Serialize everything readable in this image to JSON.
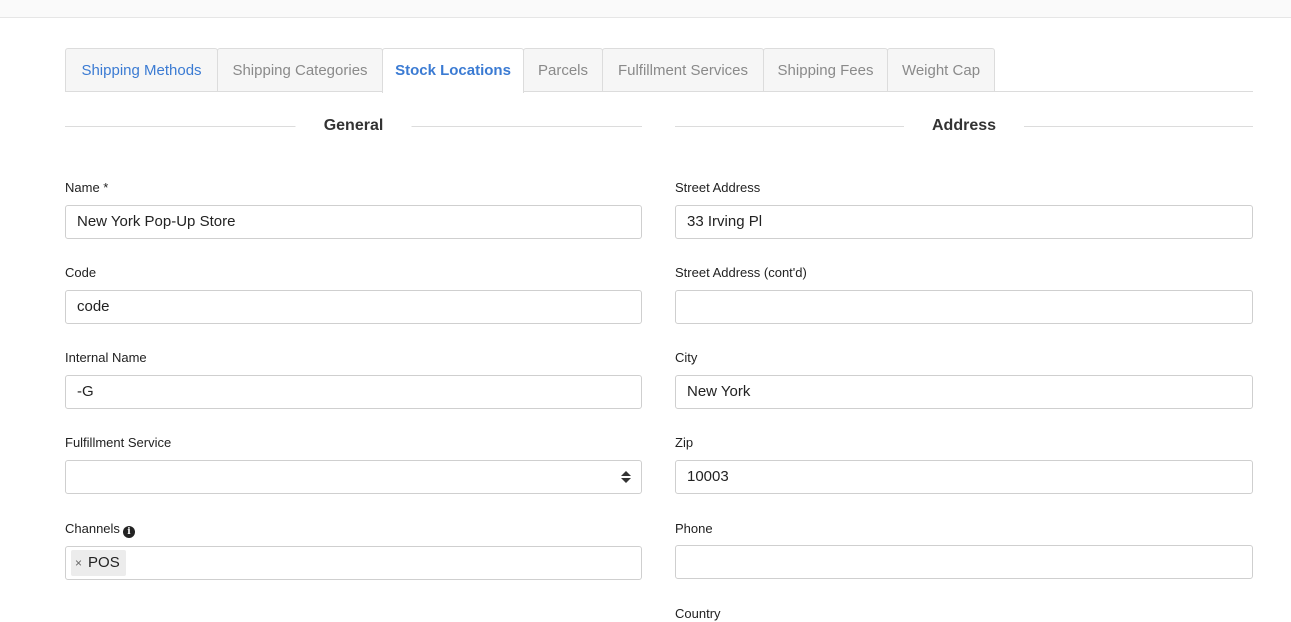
{
  "tabs": [
    {
      "label": "Shipping Methods"
    },
    {
      "label": "Shipping Categories"
    },
    {
      "label": "Stock Locations"
    },
    {
      "label": "Parcels"
    },
    {
      "label": "Fulfillment Services"
    },
    {
      "label": "Shipping Fees"
    },
    {
      "label": "Weight Cap"
    }
  ],
  "active_tab": "Stock Locations",
  "general": {
    "title": "General",
    "name_label": "Name *",
    "name_value": "New York Pop-Up Store",
    "code_label": "Code",
    "code_value": "code",
    "internal_name_label": "Internal Name",
    "internal_name_value": "-G",
    "fulfillment_label": "Fulfillment Service",
    "fulfillment_value": "",
    "channels_label": "Channels",
    "channels": [
      {
        "label": "POS",
        "remove": "×"
      }
    ]
  },
  "address": {
    "title": "Address",
    "street_label": "Street Address",
    "street_value": "33 Irving Pl",
    "street2_label": "Street Address (cont'd)",
    "street2_value": "",
    "city_label": "City",
    "city_value": "New York",
    "zip_label": "Zip",
    "zip_value": "10003",
    "phone_label": "Phone",
    "phone_value": "",
    "country_label": "Country"
  },
  "colors": {
    "accent": "#3b7bd3",
    "border": "#cfcfcf"
  }
}
